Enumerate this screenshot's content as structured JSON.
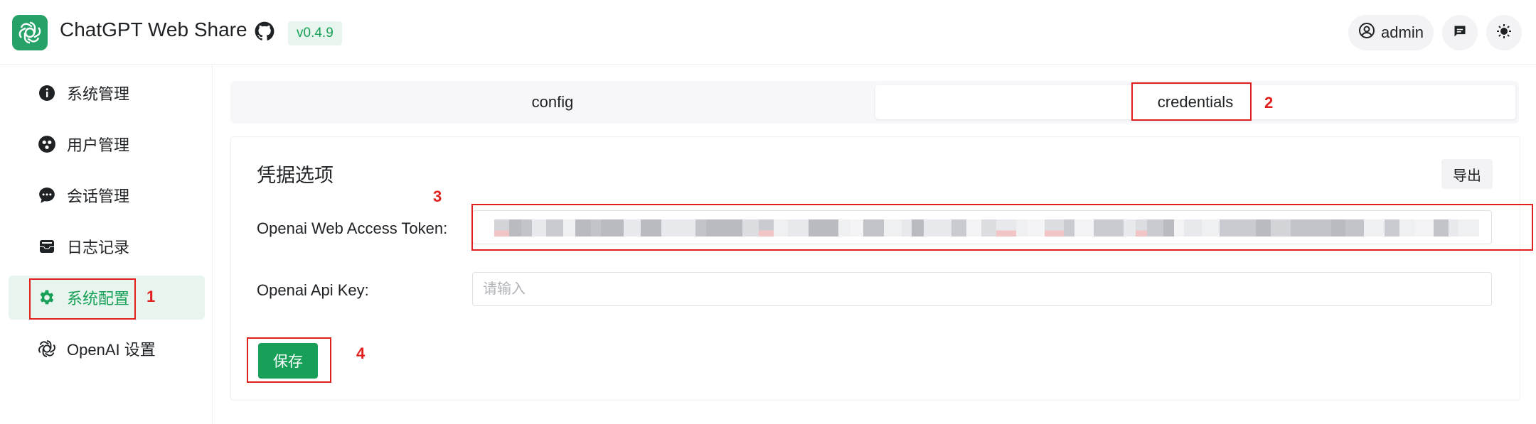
{
  "header": {
    "app_title": "ChatGPT Web Share",
    "version": "v0.4.9",
    "user_name": "admin",
    "logo_icon": "openai-logo-icon",
    "github_icon": "github-icon",
    "message_icon": "message-icon",
    "theme_icon": "sun-icon"
  },
  "sidebar": {
    "items": [
      {
        "label": "系统管理",
        "icon": "info-icon"
      },
      {
        "label": "用户管理",
        "icon": "users-icon"
      },
      {
        "label": "会话管理",
        "icon": "chat-icon"
      },
      {
        "label": "日志记录",
        "icon": "inbox-icon"
      },
      {
        "label": "系统配置",
        "icon": "gear-icon",
        "active": true
      },
      {
        "label": "OpenAI 设置",
        "icon": "openai-icon"
      }
    ]
  },
  "tabs": [
    {
      "label": "config"
    },
    {
      "label": "credentials",
      "active": true
    }
  ],
  "card": {
    "title": "凭据选项",
    "export_label": "导出",
    "fields": [
      {
        "label": "Openai Web Access Token:",
        "value": "",
        "masked": true
      },
      {
        "label": "Openai Api Key:",
        "placeholder": "请输入",
        "value": ""
      }
    ],
    "save_label": "保存"
  },
  "annotations": [
    "1",
    "2",
    "3",
    "4"
  ],
  "colors": {
    "accent": "#18a058",
    "accent_bg": "#e7f5ee",
    "annotation": "#e0201c"
  }
}
